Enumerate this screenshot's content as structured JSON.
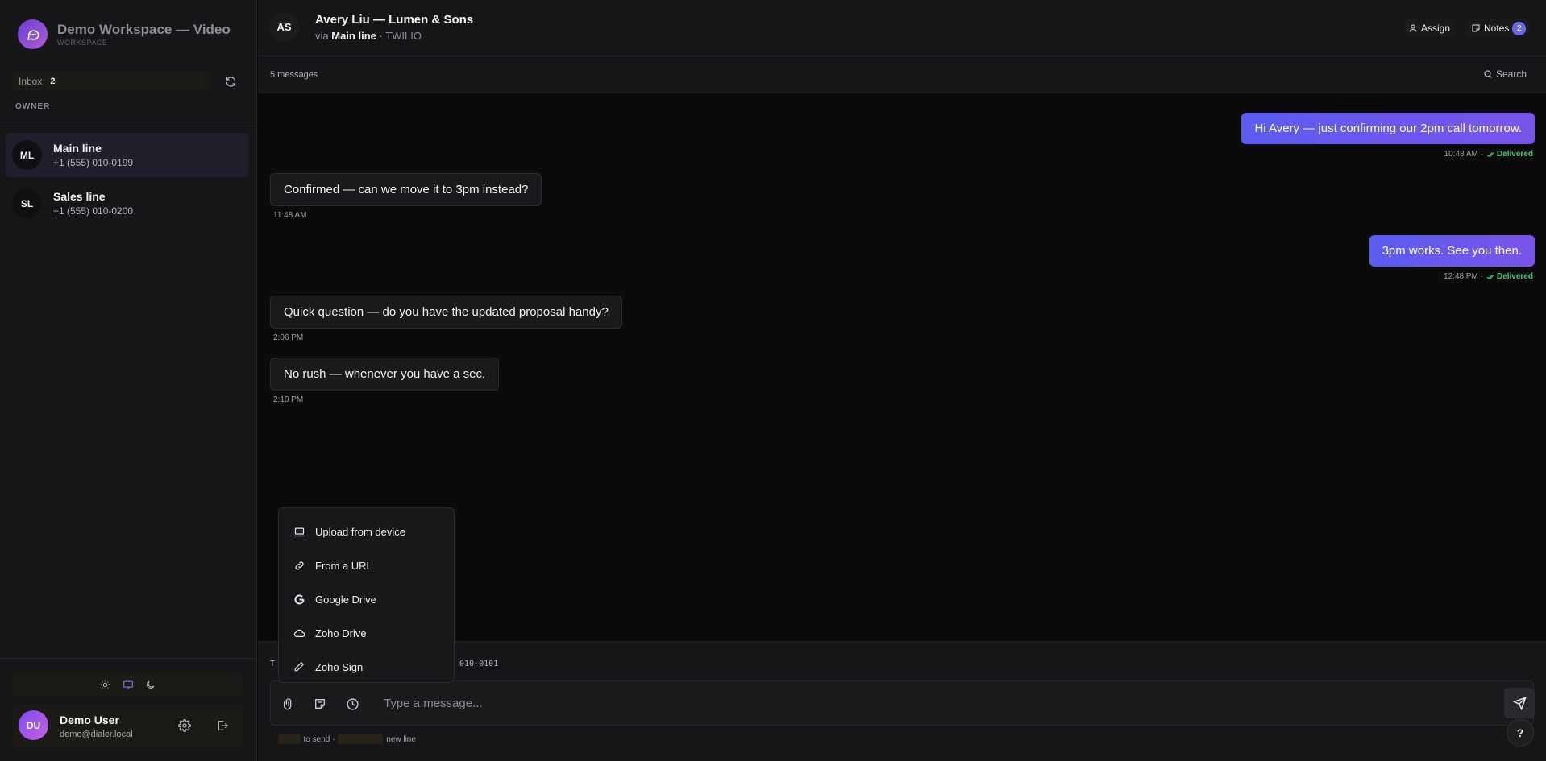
{
  "workspace": {
    "title": "Demo Workspace — Video",
    "subtitle": "WORKSPACE",
    "logo_icon": "chat-bubble-icon"
  },
  "sidebar": {
    "inbox_label": "Inbox",
    "inbox_count": "2",
    "owner_label": "OWNER",
    "lines": [
      {
        "initials": "ML",
        "name": "Main line",
        "number": "+1 (555) 010-0199",
        "active": true
      },
      {
        "initials": "SL",
        "name": "Sales line",
        "number": "+1 (555) 010-0200",
        "active": false
      }
    ],
    "theme_options": [
      "sun-icon",
      "monitor-icon",
      "moon-icon"
    ],
    "user": {
      "initials": "DU",
      "name": "Demo User",
      "email": "demo@dialer.local"
    }
  },
  "conversation": {
    "avatar": "AS",
    "contact_name": "Avery Liu — Lumen & Sons",
    "via_prefix": "via",
    "via_line": "Main line",
    "provider": "· TWILIO",
    "assign_label": "Assign",
    "notes_label": "Notes",
    "notes_count": "2",
    "message_count": "5 messages",
    "search_label": "Search"
  },
  "messages": [
    {
      "direction": "out",
      "text": "Hi Avery — just confirming our 2pm call tomorrow.",
      "time": "10:48 AM ·",
      "status": "Delivered"
    },
    {
      "direction": "in",
      "text": "Confirmed — can we move it to 3pm instead?",
      "time": "11:48 AM"
    },
    {
      "direction": "out",
      "text": "3pm works. See you then.",
      "time": "12:48 PM ·",
      "status": "Delivered"
    },
    {
      "direction": "in",
      "text": "Quick question — do you have the updated proposal handy?",
      "time": "2:06 PM"
    },
    {
      "direction": "in",
      "text": "No rush — whenever you have a sec.",
      "time": "2:10 PM"
    }
  ],
  "composer": {
    "to_prefix": "T",
    "to_number_tail": "010-0101",
    "placeholder": "Type a message...",
    "hint_send": "to send ·",
    "hint_newline": "new line",
    "help_label": "?"
  },
  "attach_menu": [
    {
      "icon": "laptop-icon",
      "label": "Upload from device"
    },
    {
      "icon": "link-icon",
      "label": "From a URL"
    },
    {
      "icon": "google-icon",
      "label": "Google Drive"
    },
    {
      "icon": "cloud-icon",
      "label": "Zoho Drive"
    },
    {
      "icon": "pen-icon",
      "label": "Zoho Sign"
    }
  ],
  "colors": {
    "accent": "#6a5cf0",
    "delivered": "#4ec17a",
    "background": "#0b0b0b",
    "panel": "#161618"
  }
}
